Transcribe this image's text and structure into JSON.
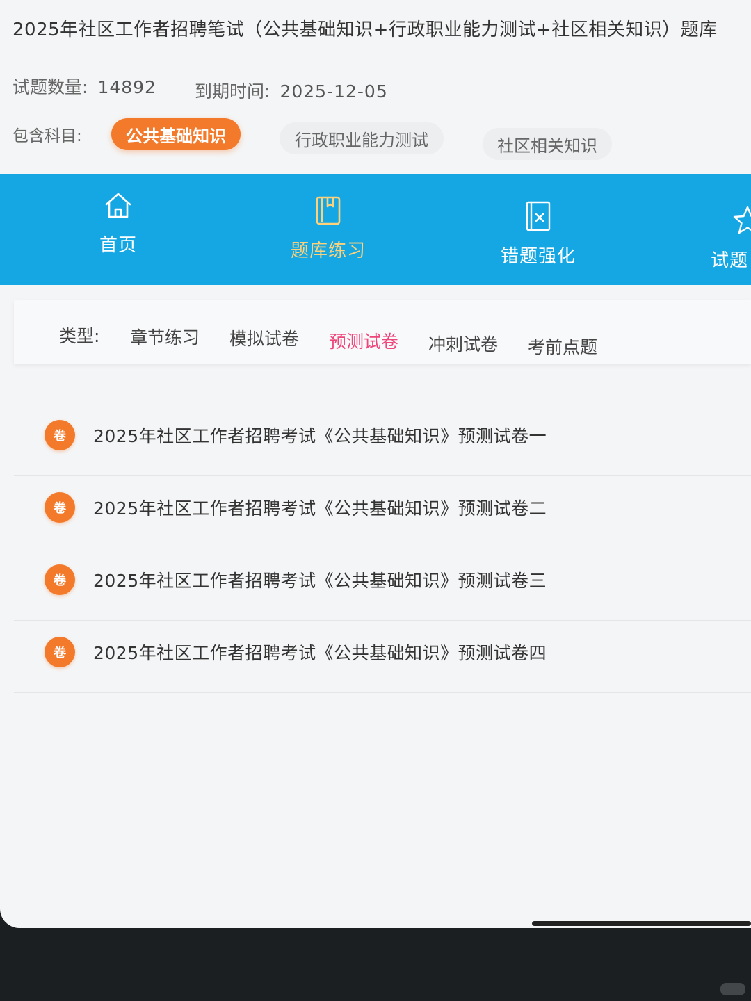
{
  "header": {
    "title": "2025年社区工作者招聘笔试（公共基础知识+行政职业能力测试+社区相关知识）题库",
    "question_count_label": "试题数量:",
    "question_count": "14892",
    "expiry_label": "到期时间:",
    "expiry_date": "2025-12-05",
    "subjects_label": "包含科目:",
    "subjects": [
      "公共基础知识",
      "行政职业能力测试",
      "社区相关知识"
    ],
    "active_subject_index": 0
  },
  "nav": {
    "items": [
      {
        "label": "首页",
        "icon": "home-icon"
      },
      {
        "label": "题库练习",
        "icon": "book-icon"
      },
      {
        "label": "错题强化",
        "icon": "wrong-questions-icon"
      },
      {
        "label": "试题",
        "icon": "star-icon"
      }
    ],
    "active_index": 1,
    "background": "#14a7e3",
    "active_color": "#ffd27a"
  },
  "types": {
    "label": "类型:",
    "tabs": [
      "章节练习",
      "模拟试卷",
      "预测试卷",
      "冲刺试卷",
      "考前点题"
    ],
    "active_index": 2,
    "active_color": "#f0457a"
  },
  "papers": {
    "badge": "卷",
    "badge_color": "#f37a2b",
    "items": [
      "2025年社区工作者招聘考试《公共基础知识》预测试卷一",
      "2025年社区工作者招聘考试《公共基础知识》预测试卷二",
      "2025年社区工作者招聘考试《公共基础知识》预测试卷三",
      "2025年社区工作者招聘考试《公共基础知识》预测试卷四"
    ]
  }
}
